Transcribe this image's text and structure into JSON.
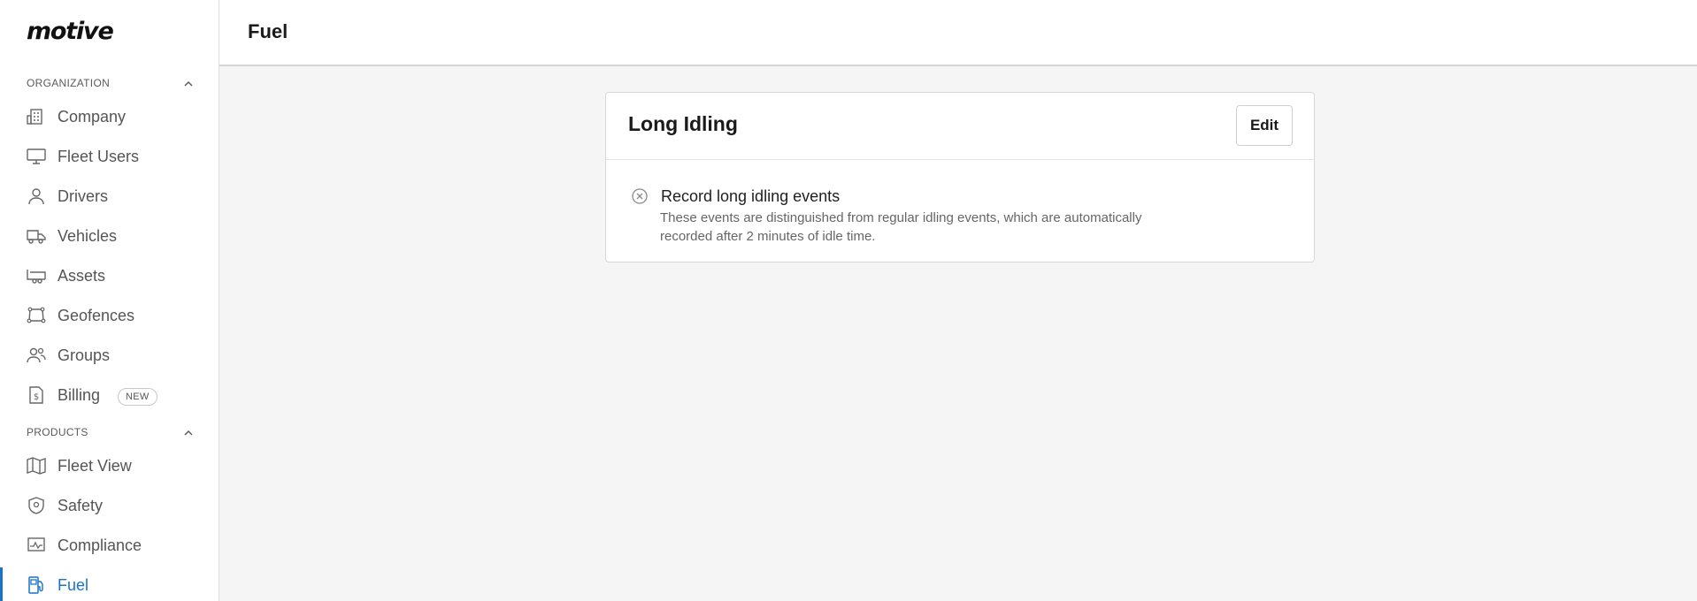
{
  "app": {
    "logo_text": "motive"
  },
  "sidebar": {
    "sections": [
      {
        "label": "ORGANIZATION",
        "items": [
          {
            "label": "Company",
            "icon": "building-icon"
          },
          {
            "label": "Fleet Users",
            "icon": "monitor-icon"
          },
          {
            "label": "Drivers",
            "icon": "person-icon"
          },
          {
            "label": "Vehicles",
            "icon": "truck-icon"
          },
          {
            "label": "Assets",
            "icon": "trailer-icon"
          },
          {
            "label": "Geofences",
            "icon": "geofence-icon"
          },
          {
            "label": "Groups",
            "icon": "group-icon"
          },
          {
            "label": "Billing",
            "icon": "billing-icon",
            "badge": "NEW"
          }
        ]
      },
      {
        "label": "PRODUCTS",
        "items": [
          {
            "label": "Fleet View",
            "icon": "map-icon"
          },
          {
            "label": "Safety",
            "icon": "shield-icon"
          },
          {
            "label": "Compliance",
            "icon": "compliance-icon"
          },
          {
            "label": "Fuel",
            "icon": "fuel-pump-icon",
            "active": true
          }
        ]
      }
    ]
  },
  "header": {
    "title": "Fuel"
  },
  "card": {
    "title": "Long Idling",
    "edit_label": "Edit",
    "setting": {
      "label": "Record long idling events",
      "description": "These events are distinguished from regular idling events, which are automatically recorded after 2 minutes of idle time.",
      "status_icon": "disabled-x-circle-icon"
    }
  },
  "colors": {
    "accent": "#1a73c9",
    "background": "#f5f5f5",
    "text_muted": "#555555"
  }
}
